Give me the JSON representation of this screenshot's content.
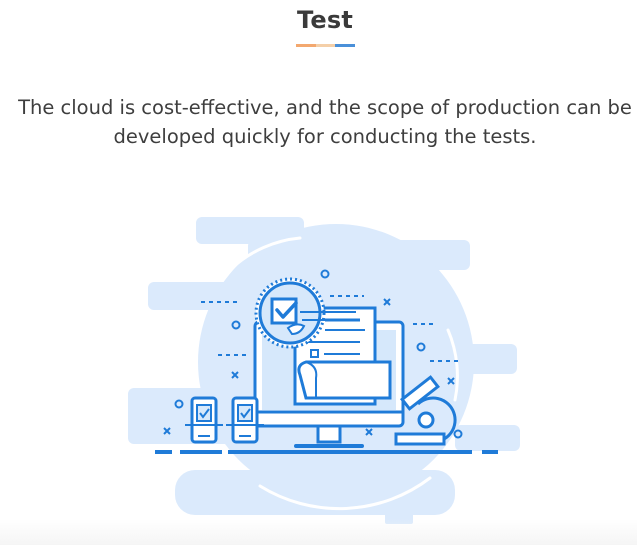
{
  "section": {
    "title": "Test",
    "description_lines": [
      "The cloud is cost-effective, and the scope of production can be",
      "developed quickly for conducting the tests."
    ]
  },
  "colors": {
    "underline_orange": "#f3a86f",
    "underline_light": "#f4cfa8",
    "underline_blue": "#4a90d9",
    "primary_blue": "#1f7bd8",
    "light_blue": "#d6e8fb",
    "mid_blue": "#bcd9f8"
  },
  "illustration": {
    "icon": "computer-test-checklist-illustration"
  }
}
